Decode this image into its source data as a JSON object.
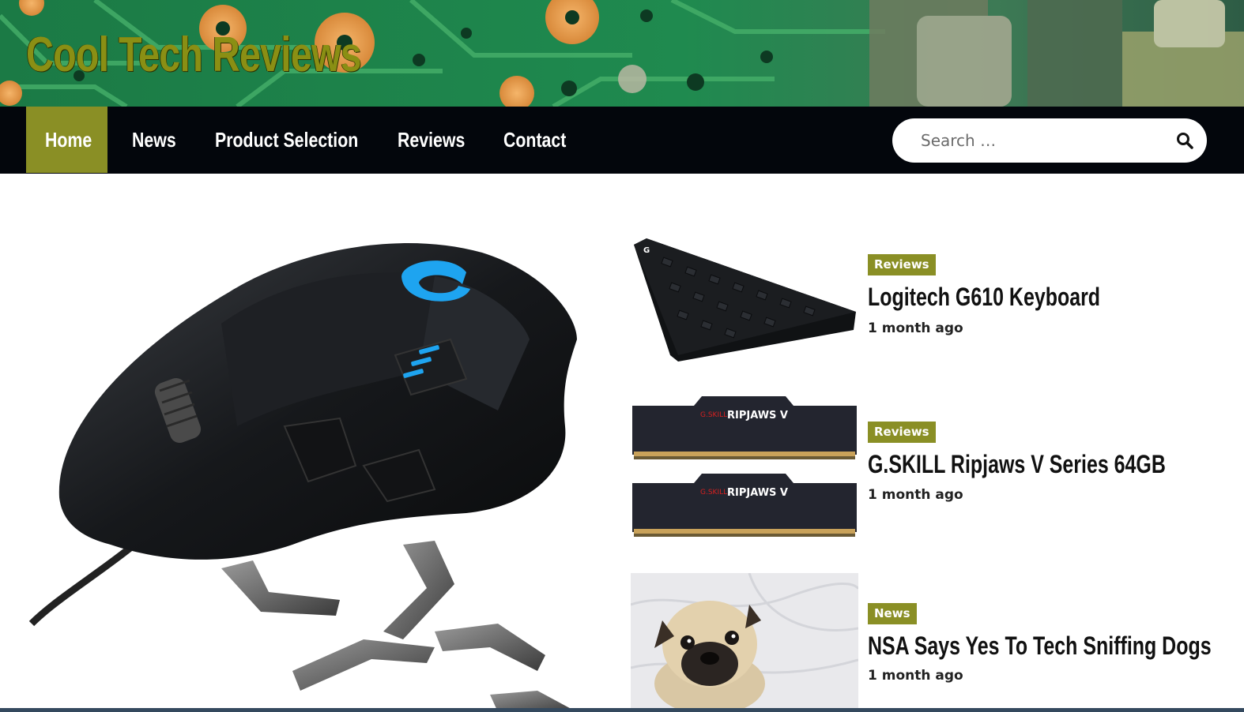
{
  "site": {
    "title": "Cool Tech Reviews"
  },
  "nav": {
    "items": [
      {
        "label": "Home",
        "active": true
      },
      {
        "label": "News",
        "active": false
      },
      {
        "label": "Product Selection",
        "active": false
      },
      {
        "label": "Reviews",
        "active": false
      },
      {
        "label": "Contact",
        "active": false
      }
    ]
  },
  "search": {
    "placeholder": "Search …",
    "icon": "search-icon"
  },
  "hero": {
    "image": "gaming-mouse-image"
  },
  "posts": [
    {
      "category": "Reviews",
      "title": "Logitech G610 Keyboard",
      "time": "1 month ago",
      "image": "keyboard-image"
    },
    {
      "category": "Reviews",
      "title": "G.SKILL Ripjaws V Series 64GB",
      "time": "1 month ago",
      "image": "ram-image"
    },
    {
      "category": "News",
      "title": "NSA Says Yes To Tech Sniffing Dogs",
      "time": "1 month ago",
      "image": "pug-image"
    }
  ],
  "colors": {
    "accent": "#8a8f25",
    "nav_bg": "#03060c",
    "title_color": "#8a8f14"
  }
}
